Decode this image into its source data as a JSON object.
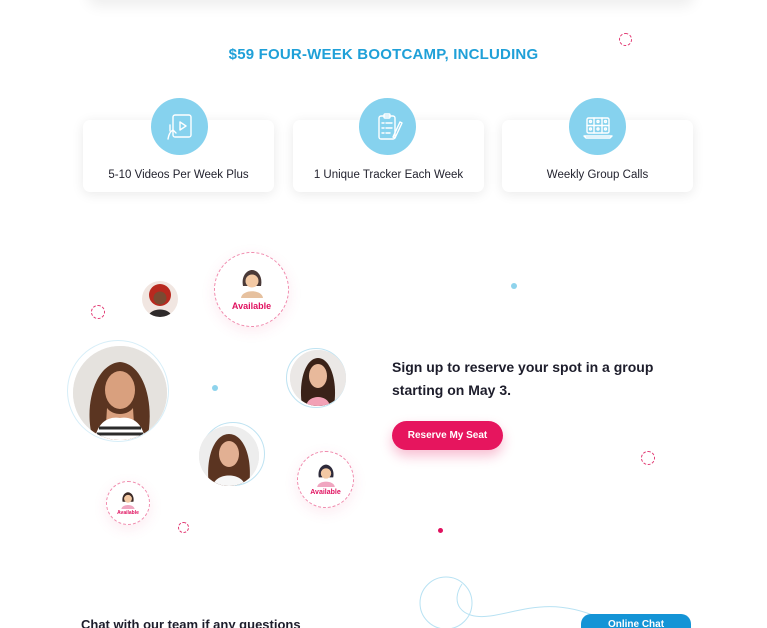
{
  "bootcamp": {
    "title": "$59 FOUR-WEEK BOOTCAMP, INCLUDING",
    "features": [
      {
        "label": "5-10 Videos Per Week Plus",
        "icon": "video-tablet-icon"
      },
      {
        "label": "1 Unique Tracker Each Week",
        "icon": "checklist-clipboard-icon"
      },
      {
        "label": "Weekly Group Calls",
        "icon": "video-conference-laptop-icon"
      }
    ]
  },
  "signup": {
    "text": "Sign up to reserve your spot in a group starting on May 3.",
    "button_label": "Reserve My Seat"
  },
  "availability": {
    "label": "Available"
  },
  "chat": {
    "text": "Chat with our team if any questions",
    "button_label": "Online Chat"
  },
  "colors": {
    "accent_blue": "#1fa0d8",
    "icon_circle": "#86d2ee",
    "accent_pink": "#e6155e",
    "chat_blue": "#1494d6"
  }
}
